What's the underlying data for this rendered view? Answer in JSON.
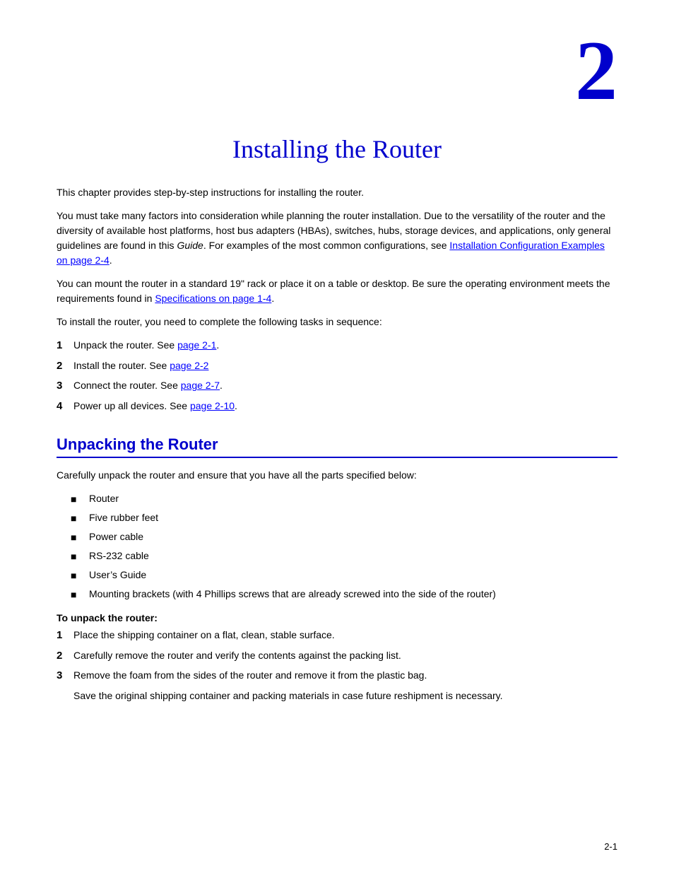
{
  "chapter": {
    "number": "2",
    "title": "Installing the Router"
  },
  "intro_paragraphs": [
    "This chapter provides step-by-step instructions for installing the router.",
    "You must take many factors into consideration while planning the router installation. Due to the versatility of the router and the diversity of available host platforms, host bus adapters (HBAs), switches, hubs, storage devices, and applications, only general guidelines are found in this Guide. For examples of the most common configurations, see",
    "You can mount the router in a standard 19\" rack or place it on a table or desktop. Be sure the operating environment meets the requirements found in",
    "To install the router, you need to complete the following tasks in sequence:"
  ],
  "links": {
    "installation_config": "Installation Configuration Examples on page 2-4",
    "specifications": "Specifications on page 1-4",
    "page_2_1": "page 2-1",
    "page_2_2": "page 2-2",
    "page_2_7": "page 2-7",
    "page_2_10": "page 2-10"
  },
  "tasks": [
    {
      "num": "1",
      "text": "Unpack the router. See ",
      "link": "page 2-1",
      "after": "."
    },
    {
      "num": "2",
      "text": "Install the router. See ",
      "link": "page 2-2",
      "after": ""
    },
    {
      "num": "3",
      "text": "Connect the router. See ",
      "link": "page 2-7",
      "after": "."
    },
    {
      "num": "4",
      "text": "Power up all devices. See ",
      "link": "page 2-10",
      "after": "."
    }
  ],
  "unpacking_section": {
    "title": "Unpacking the Router",
    "intro": "Carefully unpack the router and ensure that you have all the parts specified below:",
    "items": [
      "Router",
      "Five rubber feet",
      "Power cable",
      "RS-232 cable",
      "User’s Guide",
      "Mounting brackets (with 4 Phillips screws that are already screwed into the side of the router)"
    ]
  },
  "unpack_procedure": {
    "label": "To unpack the router:",
    "steps": [
      {
        "num": "1",
        "text": "Place the shipping container on a flat, clean, stable surface.",
        "note": ""
      },
      {
        "num": "2",
        "text": "Carefully remove the router and verify the contents against the packing list.",
        "note": ""
      },
      {
        "num": "3",
        "text": "Remove the foam from the sides of the router and remove it from the plastic bag.",
        "note": "Save the original shipping container and packing materials in case future reshipment is necessary."
      }
    ]
  },
  "page_number": "2-1"
}
